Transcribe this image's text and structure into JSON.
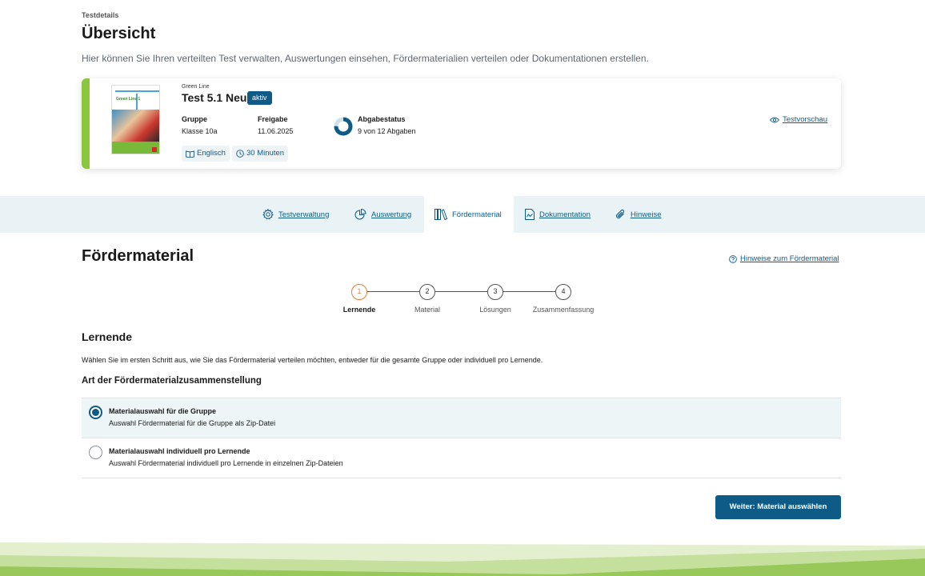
{
  "header": {
    "breadcrumb": "Testdetails",
    "title": "Übersicht",
    "description": "Hier können Sie Ihren verteilten Test verwalten, Auswertungen einsehen, Fördermaterialien verteilen oder Dokumentationen erstellen."
  },
  "test_card": {
    "series": "Green Line",
    "book_title": "Green Line 1",
    "name": "Test 5.1 Neu",
    "status_badge": "aktiv",
    "group_label": "Gruppe",
    "group_value": "Klasse 10a",
    "release_label": "Freigabe",
    "release_value": "11.06.2025",
    "submission_label": "Abgabestatus",
    "submission_value": "9 von 12 Abgaben",
    "submissions_done": 9,
    "submissions_total": 12,
    "subject": "Englisch",
    "duration": "30 Minuten",
    "preview_link": "Testvorschau"
  },
  "tabs": [
    {
      "label": "Testverwaltung",
      "icon": "gear-icon"
    },
    {
      "label": "Auswertung",
      "icon": "pie-chart-icon"
    },
    {
      "label": "Fördermaterial",
      "icon": "books-icon",
      "active": true
    },
    {
      "label": "Dokumentation",
      "icon": "document-icon"
    },
    {
      "label": "Hinweise",
      "icon": "paperclip-icon"
    }
  ],
  "section": {
    "title": "Fördermaterial",
    "hint_link": "Hinweise zum Fördermaterial"
  },
  "stepper": [
    {
      "number": "1",
      "label": "Lernende",
      "active": true
    },
    {
      "number": "2",
      "label": "Material"
    },
    {
      "number": "3",
      "label": "Lösungen"
    },
    {
      "number": "4",
      "label": "Zusammenfassung"
    }
  ],
  "step_content": {
    "heading": "Lernende",
    "instruction": "Wählen Sie im ersten Schritt aus, wie Sie das Fördermaterial verteilen möchten, entweder für die gesamte Gruppe oder individuell pro Lernende.",
    "group_heading": "Art der Fördermaterialzusammenstellung",
    "options": [
      {
        "title": "Materialauswahl für die Gruppe",
        "description": "Auswahl Fördermaterial für die Gruppe als Zip-Datei",
        "selected": true
      },
      {
        "title": "Materialauswahl individuell pro Lernende",
        "description": "Auswahl Fördermaterial individuell pro Lernende in einzelnen Zip-Dateien",
        "selected": false
      }
    ],
    "next_button": "Weiter: Material auswählen"
  },
  "colors": {
    "primary": "#0e5b87",
    "accent_green": "#8cc63f",
    "active_step": "#f07a2f",
    "tabbar_bg": "#e9f3f5"
  }
}
